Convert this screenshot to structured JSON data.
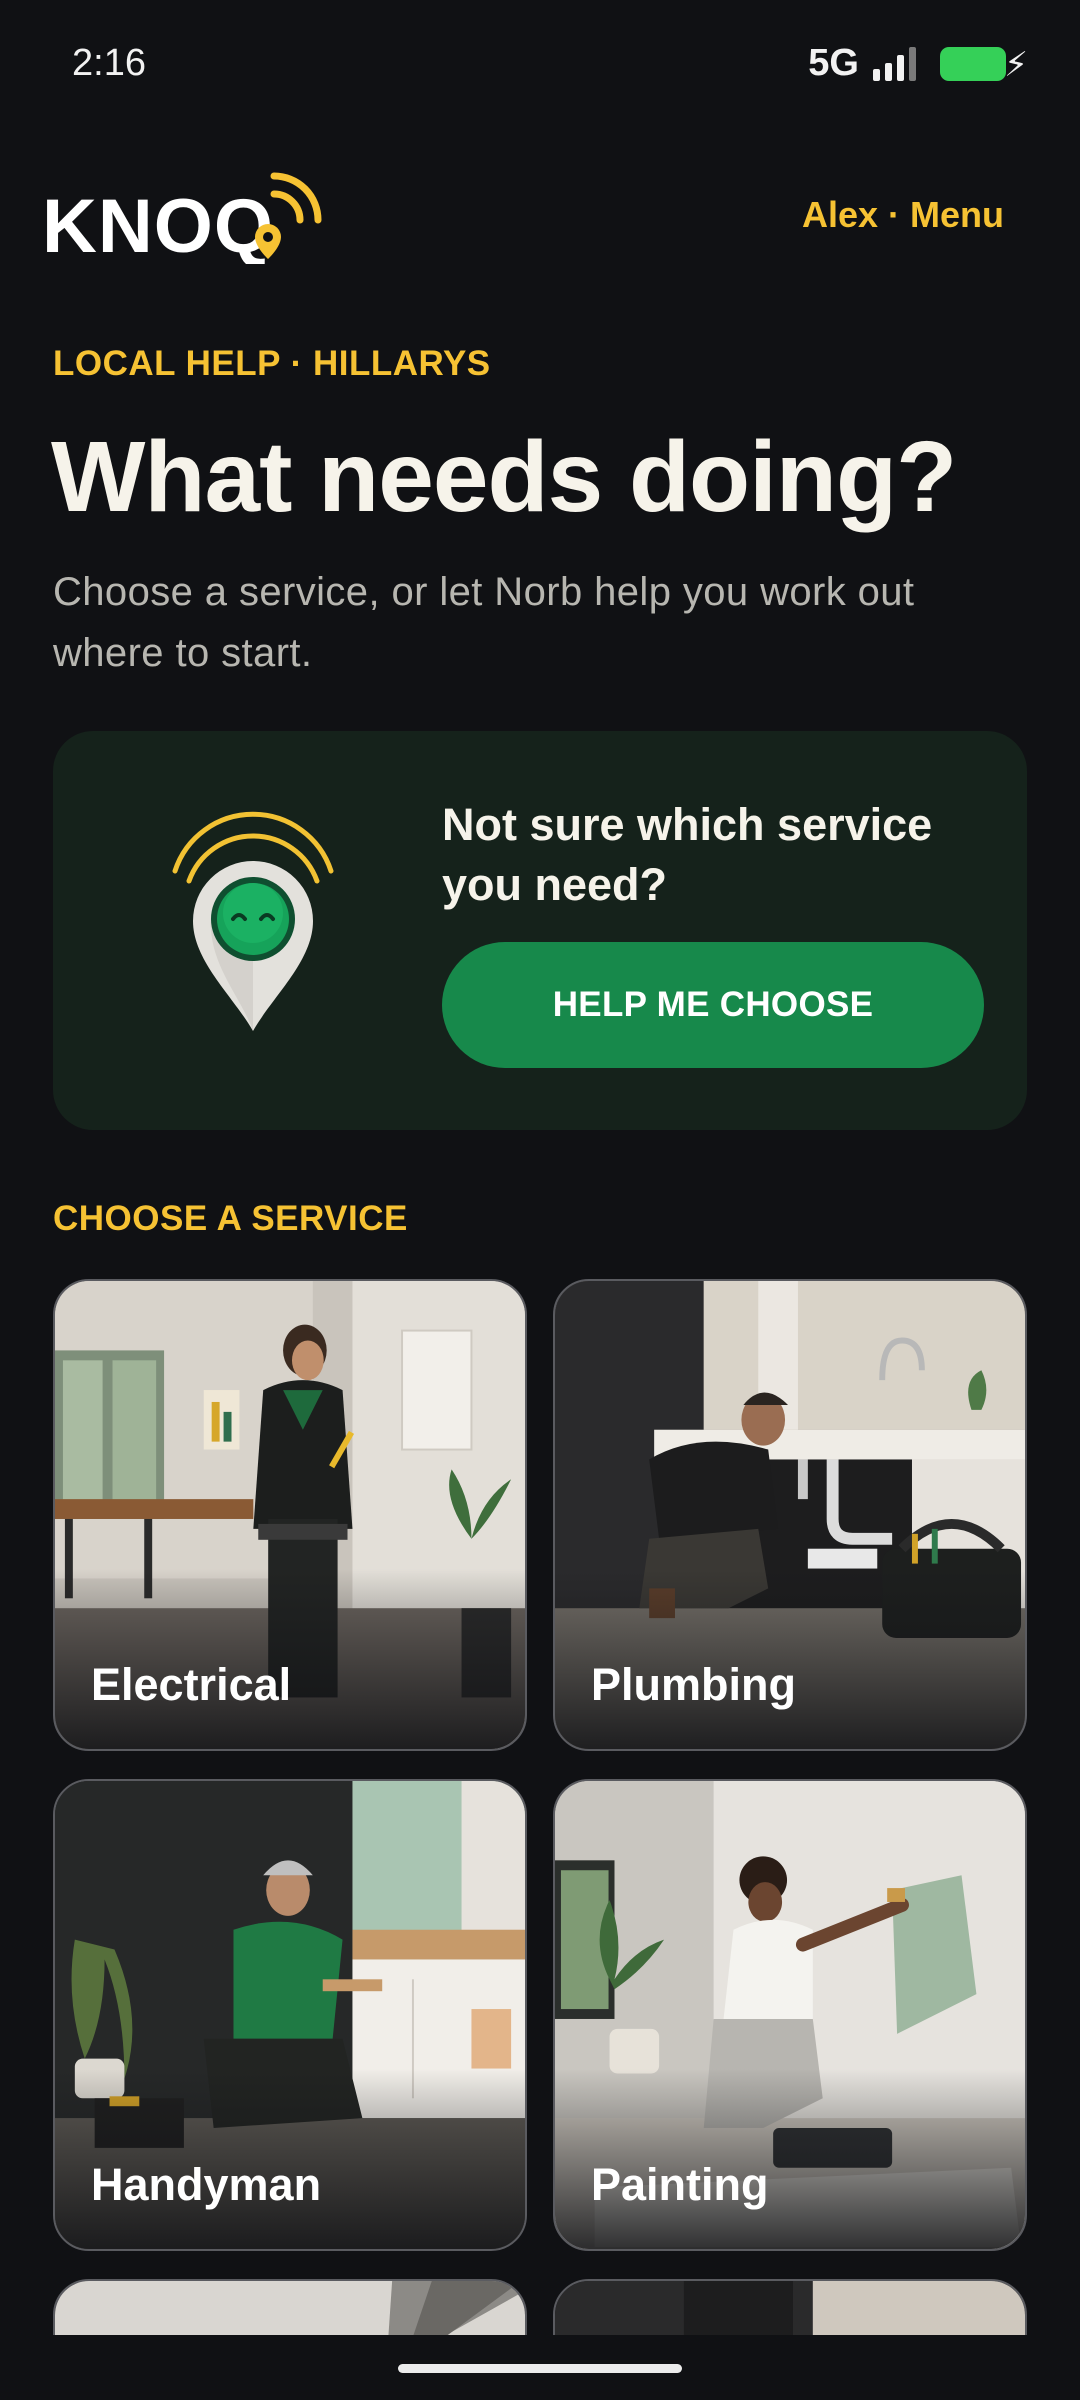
{
  "status_bar": {
    "time": "2:16",
    "network": "5G",
    "battery_icon": "battery-charging-icon",
    "signal_icon": "signal-icon",
    "battery_color": "#35d058"
  },
  "header": {
    "logo_text": "KNOQ",
    "menu_label": "Alex · Menu"
  },
  "hero": {
    "eyebrow": "LOCAL HELP · HILLARYS",
    "title": "What needs doing?",
    "subtitle": "Choose a service, or let Norb help you work out where to start."
  },
  "help_card": {
    "mascot_icon": "norb-mascot-icon",
    "question": "Not sure which service you need?",
    "button_label": "HELP ME CHOOSE"
  },
  "services": {
    "section_label": "CHOOSE A SERVICE",
    "items": [
      {
        "label": "Electrical"
      },
      {
        "label": "Plumbing"
      },
      {
        "label": "Handyman"
      },
      {
        "label": "Painting"
      }
    ]
  },
  "colors": {
    "background": "#101114",
    "accent": "#f6c233",
    "button_green": "#17894b",
    "card_green": "#15221b"
  }
}
